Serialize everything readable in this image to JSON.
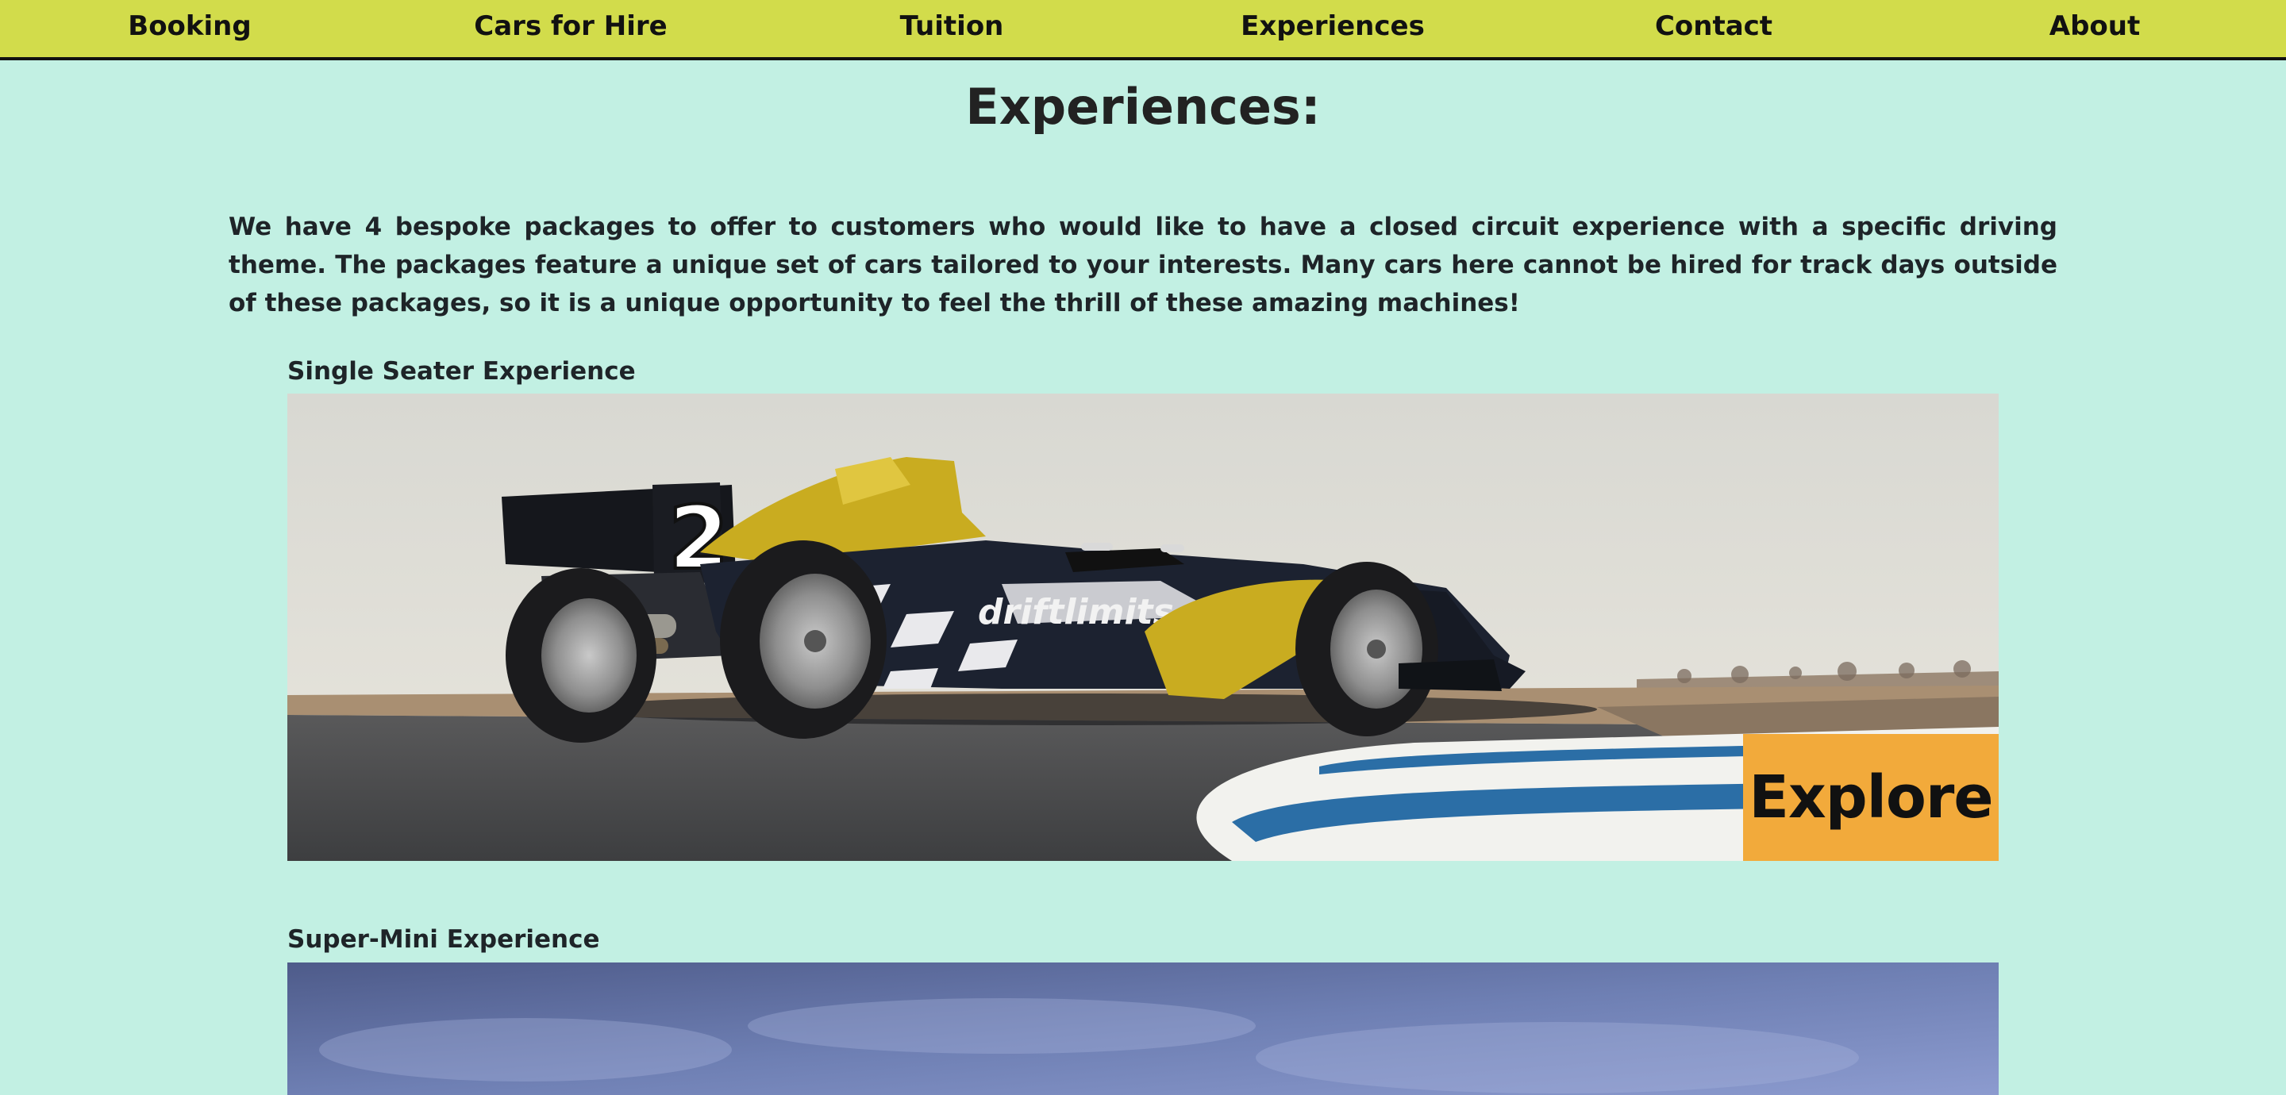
{
  "nav": {
    "items": [
      {
        "label": "Booking"
      },
      {
        "label": "Cars for Hire"
      },
      {
        "label": "Tuition"
      },
      {
        "label": "Experiences"
      },
      {
        "label": "Contact"
      },
      {
        "label": "About"
      }
    ]
  },
  "page": {
    "title": "Experiences:",
    "intro": "We have 4 bespoke packages to offer to customers who would like to have a closed circuit experience with a specific driving theme. The packages feature a unique set of cars tailored to your interests. Many cars here cannot be hired for track days outside of these packages, so it is a unique opportunity to feel the thrill of these amazing machines!"
  },
  "experiences": [
    {
      "title": "Single Seater Experience",
      "button": "Explore",
      "car_number": "2",
      "car_livery_text": "driftlimits",
      "colors": {
        "car_yellow": "#c9ac20",
        "car_body": "#1c2230",
        "kerb_blue": "#2b6ea6"
      }
    },
    {
      "title": "Super-Mini Experience"
    }
  ],
  "colors": {
    "background": "#c2f0e3",
    "nav_bar": "#d2dc4b",
    "button": "#f2aa3b",
    "text": "#1e2428"
  }
}
